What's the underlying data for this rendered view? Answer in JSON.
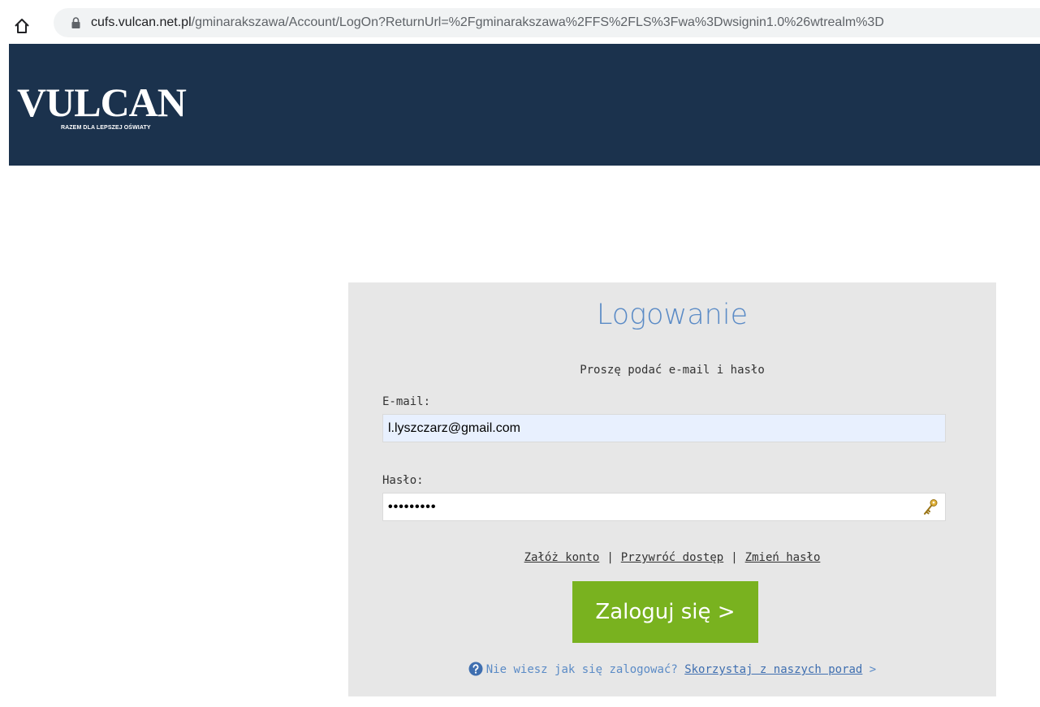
{
  "browser": {
    "url_host": "cufs.vulcan.net.pl",
    "url_path": "/gminarakszawa/Account/LogOn?ReturnUrl=%2Fgminarakszawa%2FFS%2FLS%3Fwa%3Dwsignin1.0%26wtrealm%3D"
  },
  "header": {
    "logo_text": "VULCAN",
    "logo_tagline": "RAZEM DLA LEPSZEJ OŚWIATY",
    "bg_color": "#1b324d"
  },
  "login": {
    "title": "Logowanie",
    "subtitle": "Proszę podać e-mail i hasło",
    "email_label": "E-mail:",
    "email_value": "l.lyszczarz@gmail.com",
    "password_label": "Hasło:",
    "password_value": "•••••••••",
    "links": {
      "create_account": "Załóż konto",
      "restore_access": "Przywróć dostęp",
      "change_password": "Zmień hasło",
      "separator": "|"
    },
    "submit_label": "Zaloguj się >",
    "help_text": "Nie wiesz jak się zalogować?",
    "help_link": "Skorzystaj z naszych porad",
    "help_arrow": ">",
    "accent_color": "#79b21f",
    "title_color": "#5b8bc6"
  },
  "icons": {
    "home": "home-icon",
    "lock": "lock-icon",
    "key": "key-icon",
    "help": "question-circle-icon"
  }
}
